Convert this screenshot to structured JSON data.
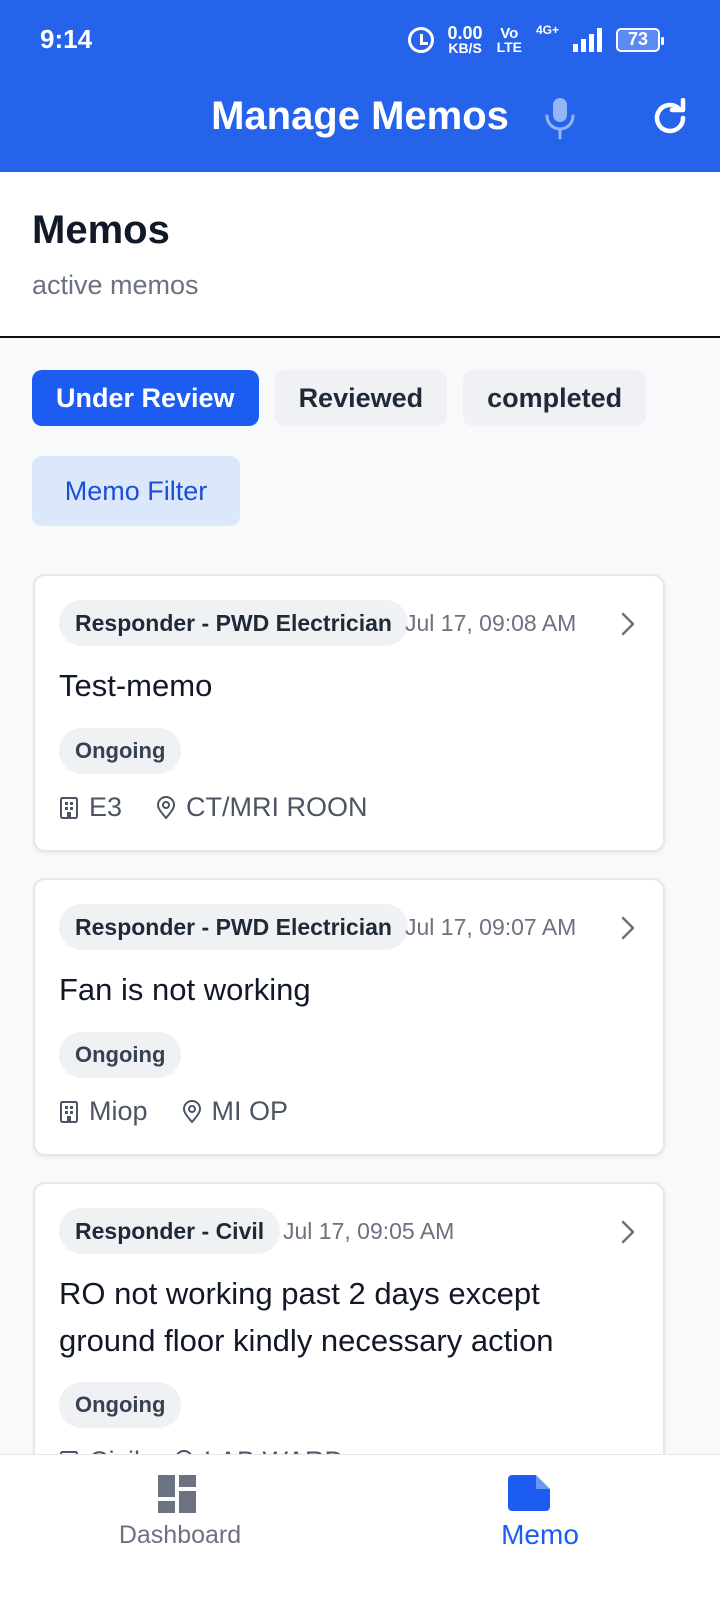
{
  "status_bar": {
    "time": "9:14",
    "net_speed": "0.00",
    "net_unit": "KB/S",
    "volte_top": "Vo",
    "volte_bottom": "LTE",
    "network": "4G+",
    "battery": "73"
  },
  "app_bar": {
    "title": "Manage Memos"
  },
  "header": {
    "title": "Memos",
    "subtitle": "active memos"
  },
  "tabs": [
    {
      "label": "Under Review",
      "active": true
    },
    {
      "label": "Reviewed",
      "active": false
    },
    {
      "label": "completed",
      "active": false
    }
  ],
  "filter": {
    "label": "Memo Filter"
  },
  "memos": [
    {
      "responder": "Responder - PWD Electrician",
      "date": "Jul 17, 09:08 AM",
      "title": "Test-memo",
      "status": "Ongoing",
      "building": "E3",
      "location": "CT/MRI ROON"
    },
    {
      "responder": "Responder - PWD Electrician",
      "date": "Jul 17, 09:07 AM",
      "title": "Fan is not working",
      "status": "Ongoing",
      "building": "Miop",
      "location": "MI OP"
    },
    {
      "responder": "Responder - Civil",
      "date": "Jul 17, 09:05 AM",
      "title_line1": "RO not working past 2 days except",
      "title_line2": "ground floor kindly necessary action",
      "status": "Ongoing",
      "building": "Civil",
      "location": "LAB WARD"
    }
  ],
  "bottom_nav": {
    "items": [
      {
        "label": "Dashboard",
        "icon": "dashboard-icon"
      },
      {
        "label": "Memo",
        "icon": "memo-icon",
        "active": true
      }
    ]
  },
  "colors": {
    "primary": "#2563eb",
    "tab_active": "#1d5cf0",
    "filter_bg": "#dbe8fc"
  }
}
